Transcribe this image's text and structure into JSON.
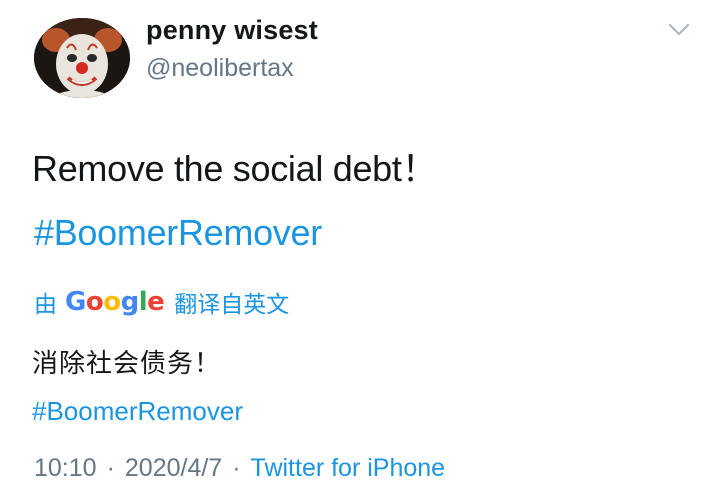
{
  "user": {
    "display_name": "penny wisest",
    "handle": "@neolibertax",
    "avatar_icon": "clown-avatar"
  },
  "tweet": {
    "text": "Remove the social debt！",
    "hashtag": "#BoomerRemover"
  },
  "translation": {
    "by_label": "由",
    "provider": "Google",
    "from_label": "翻译自英文",
    "text": "消除社会债务！",
    "hashtag": "#BoomerRemover"
  },
  "meta": {
    "time": "10:10",
    "separator": "·",
    "date": "2020/4/7",
    "source": "Twitter for iPhone"
  },
  "colors": {
    "link": "#1b95e0",
    "secondary_text": "#657786",
    "primary_text": "#14171a",
    "background": "#ffffff"
  },
  "icons": {
    "menu": "chevron-down-icon"
  }
}
